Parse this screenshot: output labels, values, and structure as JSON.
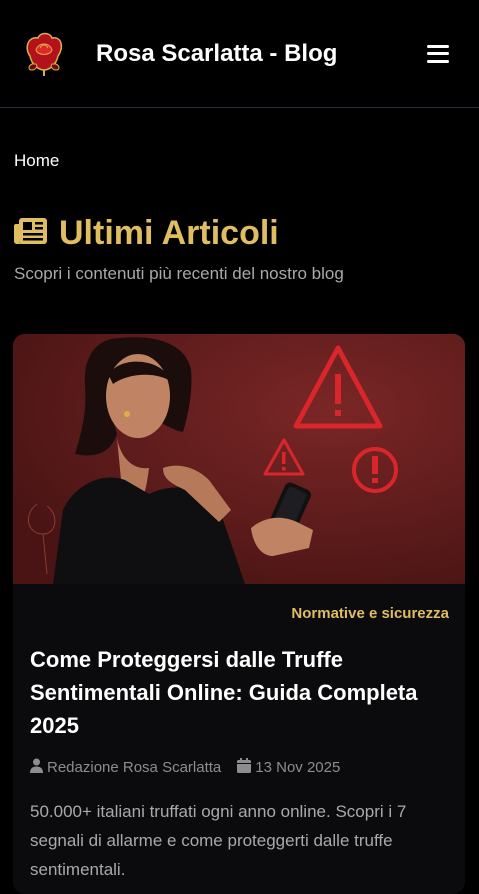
{
  "header": {
    "brand": "Rosa Scarlatta - Blog",
    "logo_icon": "rose-icon",
    "menu_icon": "hamburger-menu-icon"
  },
  "breadcrumb": {
    "home": "Home"
  },
  "section": {
    "icon": "newspaper-icon",
    "title": "Ultimi Articoli",
    "subtitle": "Scopri i contenuti più recenti del nostro blog"
  },
  "article": {
    "category": "Normative e sicurezza",
    "title": "Come Proteggersi dalle Truffe Sentimentali Online: Guida Completa 2025",
    "author": "Redazione Rosa Scarlatta",
    "date": "13 Nov 2025",
    "excerpt": "50.000+ italiani truffati ogni anno online. Scopri i 7 segnali di allarme e come proteggerti dalle truffe sentimentali."
  },
  "colors": {
    "accent": "#e1bd62",
    "background": "#000000",
    "card": "#0b0b0d"
  }
}
